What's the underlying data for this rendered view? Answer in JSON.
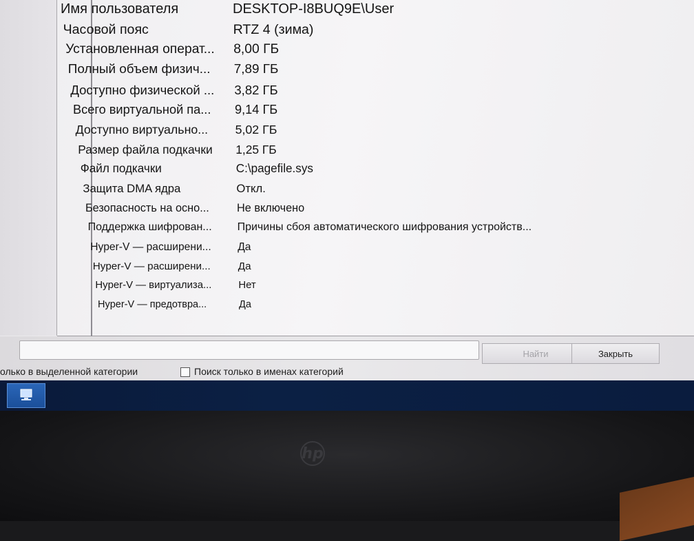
{
  "rows": [
    {
      "key": "Имя пользователя",
      "value": "DESKTOP-I8BUQ9E\\User"
    },
    {
      "key": "Часовой пояс",
      "value": "RTZ 4 (зима)"
    },
    {
      "key": "Установленная операт...",
      "value": "8,00 ГБ"
    },
    {
      "key": "Полный объем физич...",
      "value": "7,89 ГБ"
    },
    {
      "key": "Доступно физической ...",
      "value": "3,82 ГБ"
    },
    {
      "key": "Всего виртуальной па...",
      "value": "9,14 ГБ"
    },
    {
      "key": "Доступно виртуально...",
      "value": "5,02 ГБ"
    },
    {
      "key": "Размер файла подкачки",
      "value": "1,25 ГБ"
    },
    {
      "key": "Файл подкачки",
      "value": "C:\\pagefile.sys"
    },
    {
      "key": "Защита DMA ядра",
      "value": "Откл."
    },
    {
      "key": "Безопасность на осно...",
      "value": "Не включено"
    },
    {
      "key": "Поддержка шифрован...",
      "value": "Причины сбоя автоматического шифрования устройств..."
    },
    {
      "key": "Hyper-V — расширени...",
      "value": "Да"
    },
    {
      "key": "Hyper-V — расширени...",
      "value": "Да"
    },
    {
      "key": "Hyper-V — виртуализа...",
      "value": "Нет"
    },
    {
      "key": "Hyper-V — предотвра...",
      "value": "Да"
    }
  ],
  "search": {
    "value": "",
    "find_label": "Найти",
    "close_label": "Закрыть"
  },
  "options": {
    "selected_category_label": "олько в выделенной категории",
    "names_only_label": "Поиск только в именах категорий"
  },
  "bezel": {
    "brand": "hp"
  }
}
